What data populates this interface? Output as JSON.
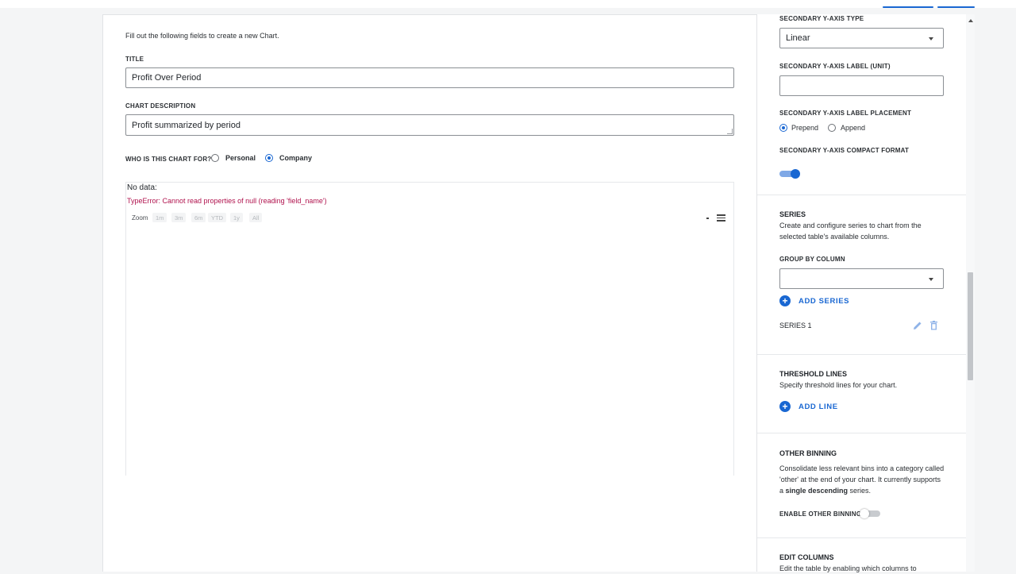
{
  "form": {
    "intro": "Fill out the following fields to create a new Chart.",
    "title_label": "TITLE",
    "title_value": "Profit Over Period",
    "description_label": "CHART DESCRIPTION",
    "description_value": "Profit summarized by period",
    "audience_label": "WHO IS THIS CHART FOR?",
    "audience_options": [
      "Personal",
      "Company"
    ],
    "audience_selected": "Company"
  },
  "chart_preview": {
    "no_data": "No data:",
    "error": "TypeError: Cannot read properties of null (reading 'field_name')",
    "zoom_label": "Zoom",
    "zoom_buttons": [
      "1m",
      "3m",
      "6m",
      "YTD",
      "1y",
      "All"
    ]
  },
  "settings": {
    "secondary_y_type_label": "SECONDARY Y-AXIS TYPE",
    "secondary_y_type_value": "Linear",
    "secondary_y_unit_label": "SECONDARY Y-AXIS LABEL (UNIT)",
    "secondary_y_unit_value": "",
    "secondary_y_placement_label": "SECONDARY Y-AXIS LABEL PLACEMENT",
    "placement_options": [
      "Prepend",
      "Append"
    ],
    "placement_selected": "Prepend",
    "secondary_y_compact_label": "SECONDARY Y-AXIS COMPACT FORMAT",
    "secondary_y_compact_enabled": true,
    "series_title": "SERIES",
    "series_desc": "Create and configure series to chart from the selected table's available columns.",
    "group_by_label": "GROUP BY COLUMN",
    "group_by_value": "",
    "add_series": "ADD SERIES",
    "series_items": [
      "SERIES 1"
    ],
    "threshold_title": "THRESHOLD LINES",
    "threshold_desc": "Specify threshold lines for your chart.",
    "add_line": "ADD LINE",
    "other_binning_title": "OTHER BINNING",
    "other_binning_desc_1": "Consolidate less relevant bins into a category called 'other' at the end of your chart. It currently supports a ",
    "other_binning_desc_bold": "single descending",
    "other_binning_desc_2": " series.",
    "enable_other_label": "ENABLE OTHER BINNING?",
    "enable_other_enabled": false,
    "edit_columns_title": "EDIT COLUMNS",
    "edit_columns_desc": "Edit the table by enabling which columns to"
  },
  "colors": {
    "accent": "#1967d2",
    "error": "#b0124d"
  }
}
